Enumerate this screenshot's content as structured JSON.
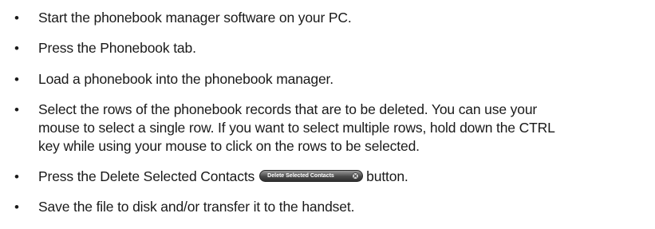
{
  "steps": [
    {
      "bullet": "•",
      "text": "Start the phonebook manager software on your PC."
    },
    {
      "bullet": "•",
      "text": "Press the Phonebook tab."
    },
    {
      "bullet": "•",
      "text": "Load a phonebook into the phonebook manager."
    },
    {
      "bullet": "•",
      "lines": [
        "Select the rows of the phonebook records that are to be deleted. You can use your",
        "mouse to select a single row. If you want to select multiple rows, hold down the CTRL",
        "key while using your mouse to click on the rows to be selected."
      ]
    },
    {
      "bullet": "•",
      "before": "Press the Delete Selected Contacts",
      "button_label": "Delete Selected Contacts",
      "button_icon": "close-x-icon",
      "after": "button."
    },
    {
      "bullet": "•",
      "text": "Save the file to disk and/or transfer it to the handset."
    }
  ]
}
